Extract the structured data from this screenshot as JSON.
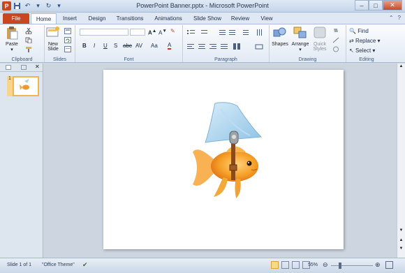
{
  "window": {
    "title": "PowerPoint Banner.pptx - Microsoft PowerPoint",
    "app_icon": "P"
  },
  "tabs": [
    "File",
    "Home",
    "Insert",
    "Design",
    "Transitions",
    "Animations",
    "Slide Show",
    "Review",
    "View"
  ],
  "ribbon": {
    "clipboard": {
      "label": "Clipboard",
      "paste": "Paste"
    },
    "slides": {
      "label": "Slides",
      "new_slide_1": "New",
      "new_slide_2": "Slide"
    },
    "font": {
      "label": "Font",
      "bold": "B",
      "italic": "I",
      "underline": "U",
      "strike": "S",
      "abc": "abc",
      "spacing": "AV",
      "case": "Aa",
      "fontcolor": "A"
    },
    "paragraph": {
      "label": "Paragraph"
    },
    "drawing": {
      "label": "Drawing",
      "shapes": "Shapes",
      "arrange": "Arrange",
      "quick_styles_1": "Quick",
      "quick_styles_2": "Styles"
    },
    "editing": {
      "label": "Editing",
      "find": "Find",
      "replace": "Replace",
      "select": "Select"
    }
  },
  "slides_panel": {
    "slide_number": "1"
  },
  "statusbar": {
    "slide_info": "Slide 1 of 1",
    "theme": "\"Office Theme\"",
    "zoom": "55%"
  },
  "colors": {
    "file_tab": "#c9471f",
    "thumb_border": "#f0b54e"
  }
}
